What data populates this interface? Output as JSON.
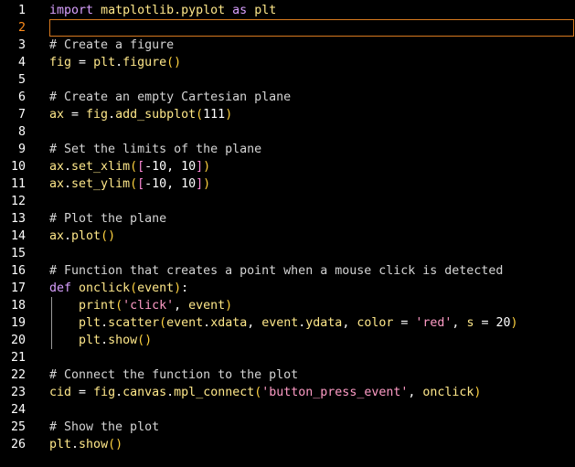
{
  "editor": {
    "lines": [
      {
        "n": "1",
        "parts": [
          [
            "kw",
            "import"
          ],
          [
            "pl",
            " "
          ],
          [
            "id",
            "matplotlib.pyplot"
          ],
          [
            "pl",
            " "
          ],
          [
            "kw",
            "as"
          ],
          [
            "pl",
            " "
          ],
          [
            "id",
            "plt"
          ]
        ]
      },
      {
        "n": "2",
        "current": true,
        "parts": []
      },
      {
        "n": "3",
        "parts": [
          [
            "cm",
            "# Create a figure"
          ]
        ]
      },
      {
        "n": "4",
        "parts": [
          [
            "id",
            "fig"
          ],
          [
            "pl",
            " = "
          ],
          [
            "id",
            "plt"
          ],
          [
            "pl",
            "."
          ],
          [
            "fn",
            "figure"
          ],
          [
            "pn",
            "()"
          ]
        ]
      },
      {
        "n": "5",
        "parts": []
      },
      {
        "n": "6",
        "parts": [
          [
            "cm",
            "# Create an empty Cartesian plane"
          ]
        ]
      },
      {
        "n": "7",
        "parts": [
          [
            "id",
            "ax"
          ],
          [
            "pl",
            " = "
          ],
          [
            "id",
            "fig"
          ],
          [
            "pl",
            "."
          ],
          [
            "fn",
            "add_subplot"
          ],
          [
            "pn",
            "("
          ],
          [
            "num",
            "111"
          ],
          [
            "pn",
            ")"
          ]
        ]
      },
      {
        "n": "8",
        "parts": []
      },
      {
        "n": "9",
        "parts": [
          [
            "cm",
            "# Set the limits of the plane"
          ]
        ]
      },
      {
        "n": "10",
        "parts": [
          [
            "id",
            "ax"
          ],
          [
            "pl",
            "."
          ],
          [
            "fn",
            "set_xlim"
          ],
          [
            "pn",
            "("
          ],
          [
            "bk",
            "["
          ],
          [
            "num",
            "-10, 10"
          ],
          [
            "bk",
            "]"
          ],
          [
            "pn",
            ")"
          ]
        ]
      },
      {
        "n": "11",
        "parts": [
          [
            "id",
            "ax"
          ],
          [
            "pl",
            "."
          ],
          [
            "fn",
            "set_ylim"
          ],
          [
            "pn",
            "("
          ],
          [
            "bk",
            "["
          ],
          [
            "num",
            "-10, 10"
          ],
          [
            "bk",
            "]"
          ],
          [
            "pn",
            ")"
          ]
        ]
      },
      {
        "n": "12",
        "parts": []
      },
      {
        "n": "13",
        "parts": [
          [
            "cm",
            "# Plot the plane"
          ]
        ]
      },
      {
        "n": "14",
        "parts": [
          [
            "id",
            "ax"
          ],
          [
            "pl",
            "."
          ],
          [
            "fn",
            "plot"
          ],
          [
            "pn",
            "()"
          ]
        ]
      },
      {
        "n": "15",
        "parts": []
      },
      {
        "n": "16",
        "parts": [
          [
            "cm",
            "# Function that creates a point when a mouse click is detected"
          ]
        ]
      },
      {
        "n": "17",
        "parts": [
          [
            "kw",
            "def"
          ],
          [
            "pl",
            " "
          ],
          [
            "fn",
            "onclick"
          ],
          [
            "pn",
            "("
          ],
          [
            "id",
            "event"
          ],
          [
            "pn",
            ")"
          ],
          [
            "pl",
            ":"
          ]
        ]
      },
      {
        "n": "18",
        "parts": [
          [
            "pl",
            "    "
          ],
          [
            "fn",
            "print"
          ],
          [
            "pn",
            "("
          ],
          [
            "str",
            "'click'"
          ],
          [
            "pl",
            ", "
          ],
          [
            "id",
            "event"
          ],
          [
            "pn",
            ")"
          ]
        ]
      },
      {
        "n": "19",
        "parts": [
          [
            "pl",
            "    "
          ],
          [
            "id",
            "plt"
          ],
          [
            "pl",
            "."
          ],
          [
            "fn",
            "scatter"
          ],
          [
            "pn",
            "("
          ],
          [
            "id",
            "event"
          ],
          [
            "pl",
            "."
          ],
          [
            "id",
            "xdata"
          ],
          [
            "pl",
            ", "
          ],
          [
            "id",
            "event"
          ],
          [
            "pl",
            "."
          ],
          [
            "id",
            "ydata"
          ],
          [
            "pl",
            ", "
          ],
          [
            "id",
            "color"
          ],
          [
            "pl",
            " = "
          ],
          [
            "str",
            "'red'"
          ],
          [
            "pl",
            ", "
          ],
          [
            "id",
            "s"
          ],
          [
            "pl",
            " = "
          ],
          [
            "num",
            "20"
          ],
          [
            "pn",
            ")"
          ]
        ]
      },
      {
        "n": "20",
        "parts": [
          [
            "pl",
            "    "
          ],
          [
            "id",
            "plt"
          ],
          [
            "pl",
            "."
          ],
          [
            "fn",
            "show"
          ],
          [
            "pn",
            "()"
          ]
        ]
      },
      {
        "n": "21",
        "parts": []
      },
      {
        "n": "22",
        "parts": [
          [
            "cm",
            "# Connect the function to the plot"
          ]
        ]
      },
      {
        "n": "23",
        "parts": [
          [
            "id",
            "cid"
          ],
          [
            "pl",
            " = "
          ],
          [
            "id",
            "fig"
          ],
          [
            "pl",
            "."
          ],
          [
            "id",
            "canvas"
          ],
          [
            "pl",
            "."
          ],
          [
            "fn",
            "mpl_connect"
          ],
          [
            "pn",
            "("
          ],
          [
            "str",
            "'button_press_event'"
          ],
          [
            "pl",
            ", "
          ],
          [
            "id",
            "onclick"
          ],
          [
            "pn",
            ")"
          ]
        ]
      },
      {
        "n": "24",
        "parts": []
      },
      {
        "n": "25",
        "parts": [
          [
            "cm",
            "# Show the plot"
          ]
        ]
      },
      {
        "n": "26",
        "parts": [
          [
            "id",
            "plt"
          ],
          [
            "pl",
            "."
          ],
          [
            "fn",
            "show"
          ],
          [
            "pn",
            "()"
          ]
        ]
      }
    ]
  }
}
